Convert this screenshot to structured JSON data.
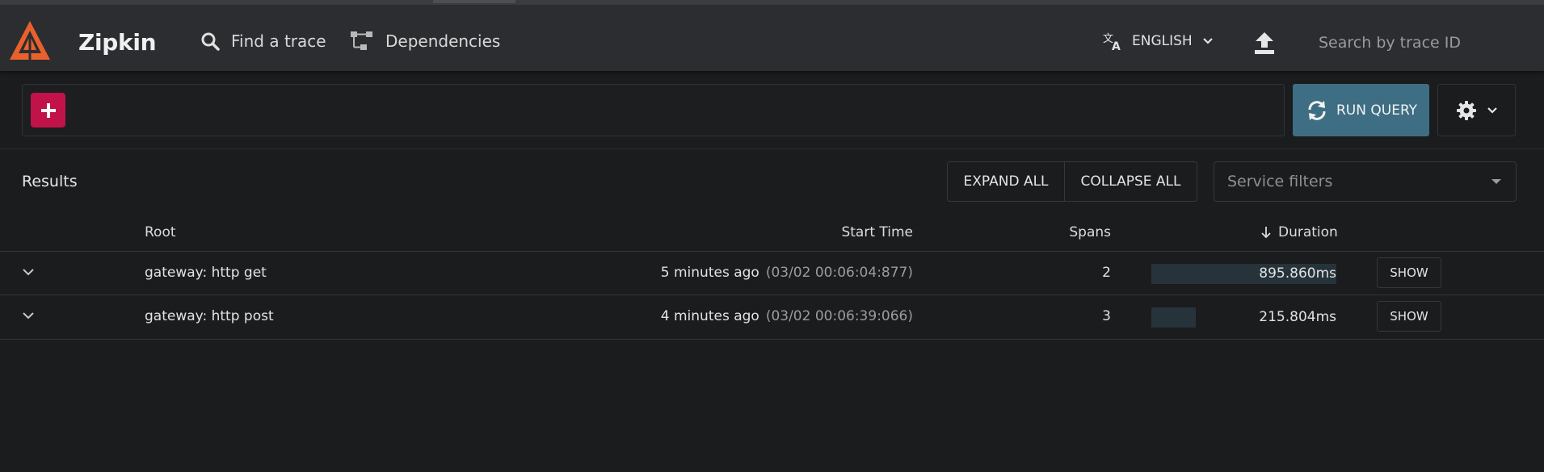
{
  "header": {
    "brand": "Zipkin",
    "nav": {
      "find_trace": "Find a trace",
      "dependencies": "Dependencies"
    },
    "language": "ENGLISH",
    "search_placeholder": "Search by trace ID",
    "logo_color": "#e8612c"
  },
  "query": {
    "run_label": "RUN QUERY",
    "add_color": "#c2124a",
    "run_color": "#3e6e83"
  },
  "results": {
    "label": "Results",
    "expand_all": "EXPAND ALL",
    "collapse_all": "COLLAPSE ALL",
    "service_filter_placeholder": "Service filters",
    "columns": {
      "root": "Root",
      "start_time": "Start Time",
      "spans": "Spans",
      "duration": "Duration"
    },
    "rows": [
      {
        "root": "gateway: http get",
        "start_relative": "5 minutes ago",
        "start_absolute": "(03/02 00:06:04:877)",
        "spans": "2",
        "duration": "895.860ms",
        "duration_fraction": 1.0,
        "show": "SHOW"
      },
      {
        "root": "gateway: http post",
        "start_relative": "4 minutes ago",
        "start_absolute": "(03/02 00:06:39:066)",
        "spans": "3",
        "duration": "215.804ms",
        "duration_fraction": 0.241,
        "show": "SHOW"
      }
    ]
  }
}
